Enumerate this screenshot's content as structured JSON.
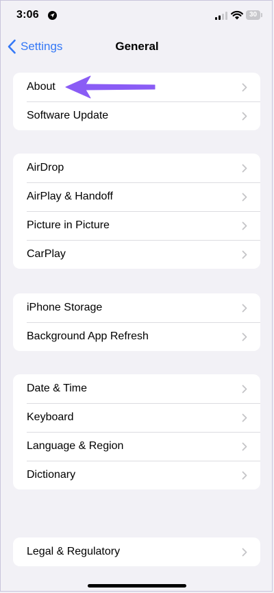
{
  "status_bar": {
    "time": "3:06",
    "battery": "30"
  },
  "nav": {
    "back_label": "Settings",
    "title": "General"
  },
  "groups": [
    {
      "items": [
        {
          "label": "About"
        },
        {
          "label": "Software Update"
        }
      ]
    },
    {
      "items": [
        {
          "label": "AirDrop"
        },
        {
          "label": "AirPlay & Handoff"
        },
        {
          "label": "Picture in Picture"
        },
        {
          "label": "CarPlay"
        }
      ]
    },
    {
      "items": [
        {
          "label": "iPhone Storage"
        },
        {
          "label": "Background App Refresh"
        }
      ]
    },
    {
      "items": [
        {
          "label": "Date & Time"
        },
        {
          "label": "Keyboard"
        },
        {
          "label": "Language & Region"
        },
        {
          "label": "Dictionary"
        }
      ]
    },
    {
      "items": [
        {
          "label": "Legal & Regulatory"
        }
      ]
    }
  ],
  "icons": {
    "back": "chevron-left-icon",
    "row": "chevron-right-icon",
    "location": "location-icon",
    "signal": "signal-icon",
    "wifi": "wifi-icon",
    "battery": "battery-icon",
    "annotation": "arrow-annotation"
  },
  "colors": {
    "background": "#f2f1f6",
    "accent": "#3478f6",
    "annotation": "#8a5cf5",
    "chevron": "#c4c4c7"
  }
}
